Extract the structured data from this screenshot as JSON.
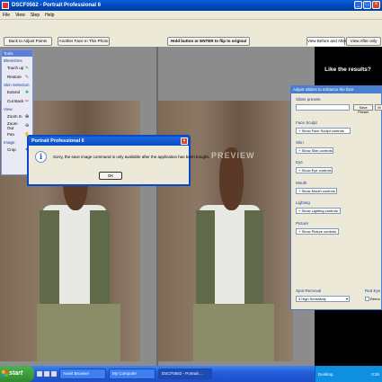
{
  "window": {
    "title": "DSCF0562 - Portrait Professional 6"
  },
  "menu": [
    "File",
    "View",
    "Step",
    "Help"
  ],
  "toolbar": {
    "back_label": "Back to Adjust Points",
    "another_face_label": "Another Face In This Photo",
    "hold_label": "Hold button or ENTER to flip to original",
    "view_before_after_label": "View Before and After",
    "view_after_only_label": "View After only"
  },
  "tools_panel": {
    "header": "Tools",
    "groups": [
      {
        "title": "Blemishes",
        "items": [
          {
            "label": "Touch up"
          },
          {
            "label": "Restore"
          }
        ]
      },
      {
        "title": "Skin Selection",
        "items": [
          {
            "label": "Extend"
          },
          {
            "label": "Cut Back"
          }
        ]
      },
      {
        "title": "View",
        "items": [
          {
            "label": "Zoom In"
          },
          {
            "label": "Zoom Out"
          },
          {
            "label": "Pan"
          }
        ]
      },
      {
        "title": "Image",
        "items": [
          {
            "label": "Crop"
          }
        ]
      }
    ]
  },
  "promo": {
    "text": "Like the results?"
  },
  "watermark": "PREVIEW",
  "enhance_panel": {
    "header": "Adjust sliders to enhance the face",
    "presets_label": "Slider presets",
    "reset_label": "Save Preset",
    "reset2_label": "M",
    "sections": [
      {
        "title": "Face Sculpt",
        "button": "+ Show Face Sculpt controls"
      },
      {
        "title": "Skin",
        "button": "+ Show Skin controls"
      },
      {
        "title": "Eye",
        "button": "+ Show Eye controls"
      },
      {
        "title": "Mouth",
        "button": "+ Show Mouth controls"
      },
      {
        "title": "Lighting",
        "button": "+ Show Lighting controls"
      },
      {
        "title": "Picture",
        "button": "+ Show Picture controls"
      }
    ],
    "spot_removal_label": "Spot Removal",
    "spot_removal_value": "3 High Sensitivity",
    "red_eye_label": "Red Eye",
    "remove_label": "Remo"
  },
  "dialog": {
    "title": "Portrait Professional 6",
    "message": "Sorry, the save image command is only available after the application has been bought.",
    "ok_label": "OK"
  },
  "taskbar": {
    "start_label": "start",
    "tasks": [
      "Avant Browser",
      "My Computer",
      "DSCF0562 - Portrait ..."
    ],
    "tray_label": "Desktop",
    "clock": "0:26"
  },
  "colors": {
    "titlebar": "#0046b8",
    "taskbar": "#245edb",
    "start": "#2f8a2f",
    "panel_header": "#4a7fd0"
  }
}
